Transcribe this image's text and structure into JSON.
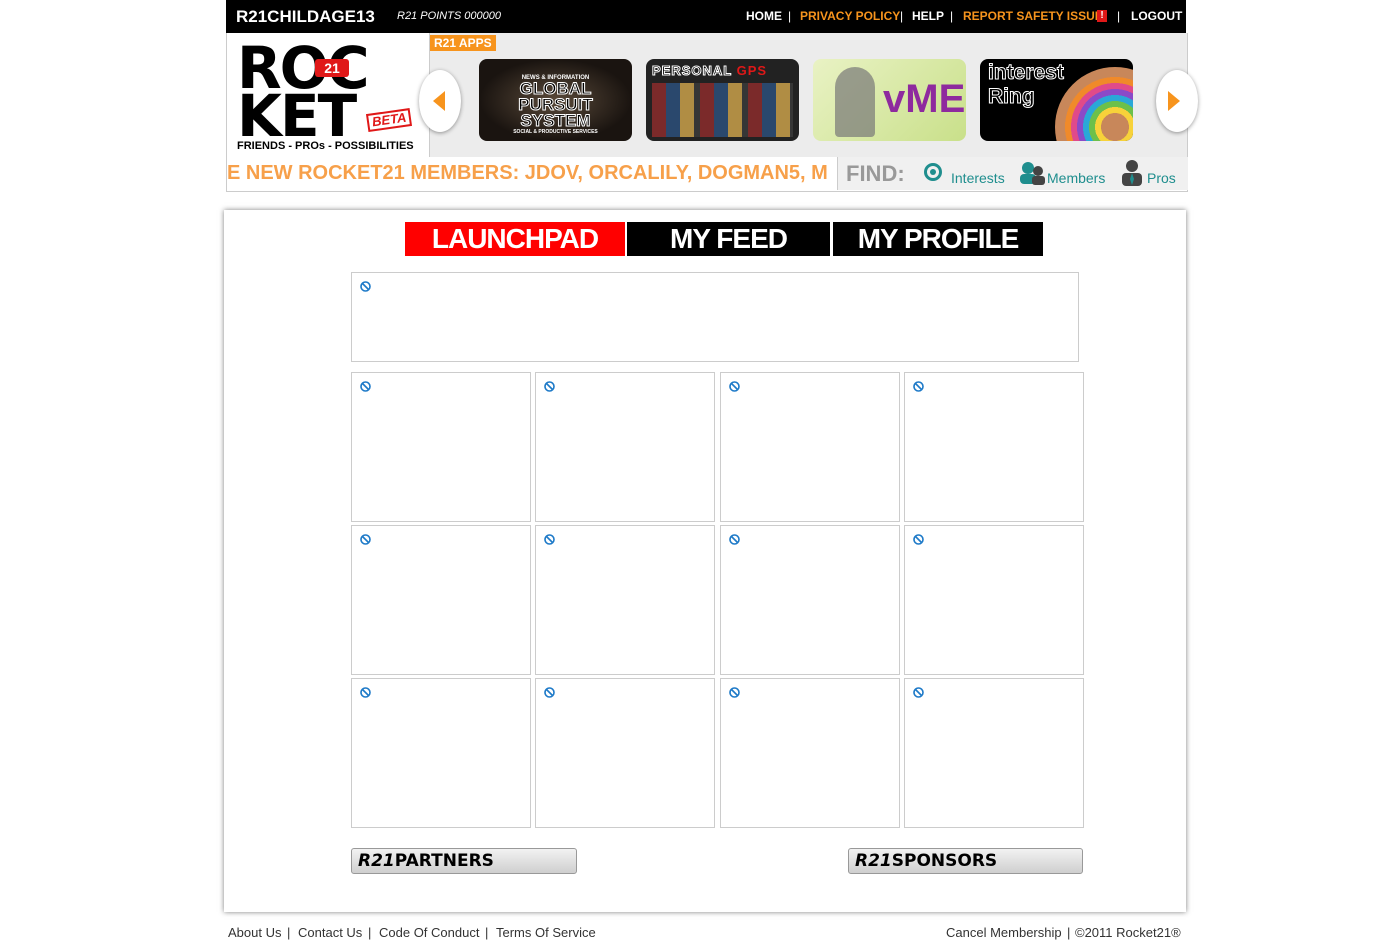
{
  "topbar": {
    "username": "R21CHILDAGE13",
    "points": "R21 POINTS 000000",
    "nav": {
      "home": "HOME",
      "privacy": "PRIVACY POLICY",
      "help": "HELP",
      "report": "REPORT SAFETY ISSUE",
      "report_badge": "!",
      "logout": "LOGOUT"
    },
    "separator": "|"
  },
  "logo": {
    "row1": "ROC",
    "row1b": "KET",
    "badge": "21",
    "beta": "BETA",
    "tagline": "FRIENDS - PROs - POSSIBILITIES"
  },
  "apps": {
    "label": "R21 APPS",
    "tiles": [
      {
        "line1": "NEWS & INFORMATION",
        "line2": "GLOBAL",
        "line3": "PURSUIT",
        "line4": "SYSTEM",
        "line5": "SOCIAL & PRODUCTIVE SERVICES"
      },
      {
        "title": "PERSONAL",
        "accent": "GPS"
      },
      {
        "title": "vME"
      },
      {
        "title": "interest",
        "sub": "Ring"
      }
    ]
  },
  "ticker": {
    "text": "E NEW ROCKET21 MEMBERS: JDOV, ORCALILY, DOGMAN5, M"
  },
  "find": {
    "label": "FIND:",
    "interests": "Interests",
    "members": "Members",
    "pros": "Pros"
  },
  "tabs": {
    "launchpad": "LAUNCHPAD",
    "feed": "MY FEED",
    "profile": "MY PROFILE"
  },
  "colors": {
    "accent_orange": "#f7941d",
    "active_tab": "#ff0000",
    "tab_bg": "#000000",
    "teal": "#1f8e8e"
  },
  "partners": {
    "partners_r21": "R21",
    "partners_label": "PARTNERS",
    "sponsors_r21": "R21",
    "sponsors_label": "SPONSORS"
  },
  "footer": {
    "about": "About Us",
    "contact": "Contact Us",
    "conduct": "Code Of Conduct",
    "terms": "Terms Of Service",
    "cancel": "Cancel Membership",
    "copyright": "©2011 Rocket21®",
    "separator": "|"
  }
}
